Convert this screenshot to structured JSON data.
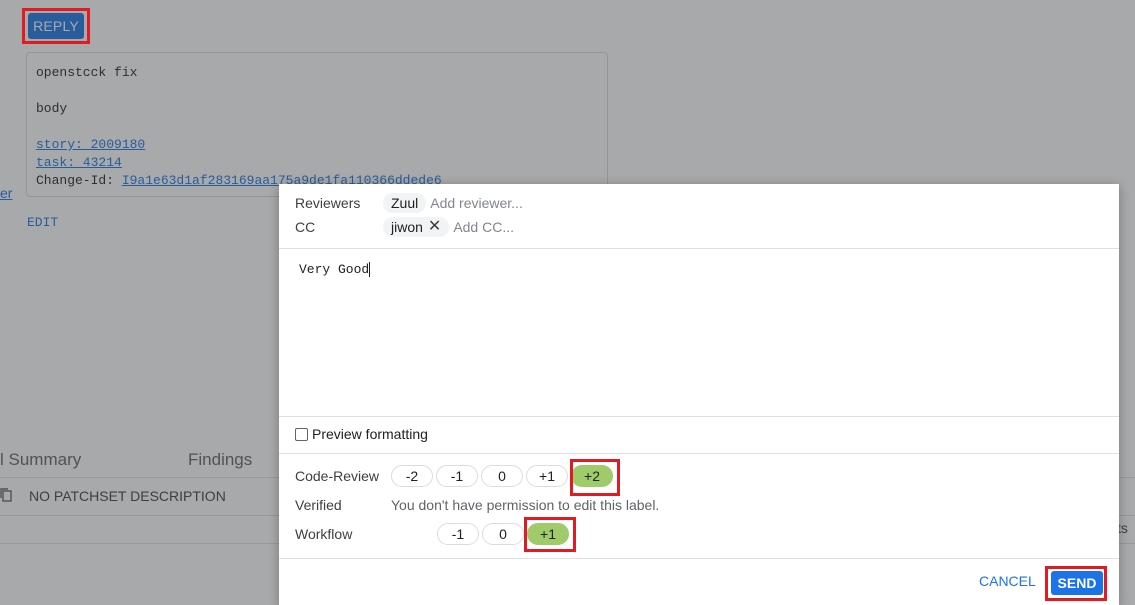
{
  "header": {
    "reply_label": "REPLY"
  },
  "commit": {
    "subject": "openstcck fix",
    "body": "body",
    "story": "story: 2009180",
    "task": "task: 43214",
    "change_id_label": "Change-Id: ",
    "change_id": "I9a1e63d1af283169aa175a9de1fa110366ddede6"
  },
  "side_link": "er",
  "edit_label": "EDIT",
  "tabs": {
    "summary": "l Summary",
    "findings": "Findings"
  },
  "patchset": {
    "description": "NO PATCHSET DESCRIPTION"
  },
  "right_text": "ts",
  "dialog": {
    "reviewers_label": "Reviewers",
    "reviewers": [
      "Zuul"
    ],
    "reviewer_placeholder": "Add reviewer...",
    "cc_label": "CC",
    "cc": [
      "jiwon"
    ],
    "cc_placeholder": "Add CC...",
    "message": "Very Good",
    "preview_label": "Preview formatting",
    "labels": {
      "code_review": {
        "name": "Code-Review",
        "values": [
          "-2",
          "-1",
          "0",
          "+1",
          "+2"
        ],
        "selected": "+2"
      },
      "verified": {
        "name": "Verified",
        "note": "You don't have permission to edit this label."
      },
      "workflow": {
        "name": "Workflow",
        "values": [
          "-1",
          "0",
          "+1"
        ],
        "selected": "+1"
      }
    },
    "cancel_label": "CANCEL",
    "send_label": "SEND"
  },
  "colors": {
    "accent": "#1a73e8",
    "vote_selected": "#9fcb6b",
    "highlight": "#e01b24"
  }
}
